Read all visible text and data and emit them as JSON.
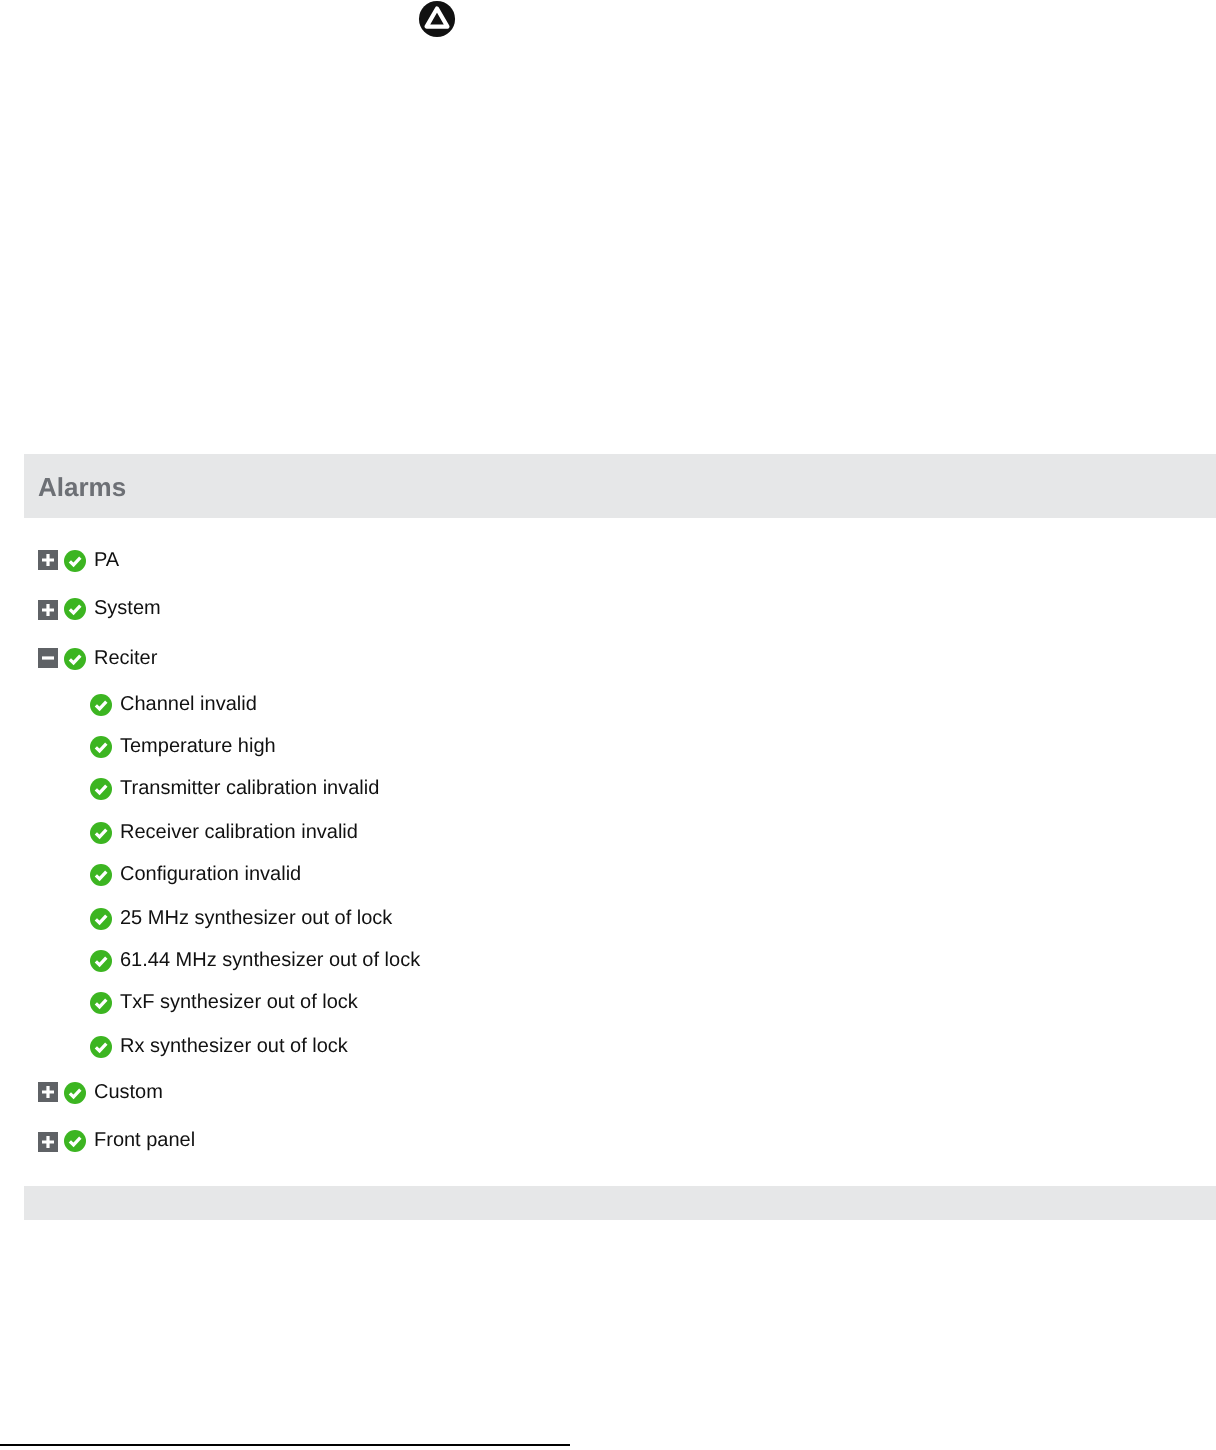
{
  "panel": {
    "title": "Alarms",
    "items": [
      {
        "label": "PA",
        "expanded": false
      },
      {
        "label": "System",
        "expanded": false
      },
      {
        "label": "Reciter",
        "expanded": true,
        "children": [
          {
            "label": "Channel invalid"
          },
          {
            "label": "Temperature high"
          },
          {
            "label": "Transmitter calibration invalid"
          },
          {
            "label": "Receiver calibration invalid"
          },
          {
            "label": "Configuration invalid"
          },
          {
            "label": "25 MHz synthesizer out of lock"
          },
          {
            "label": "61.44 MHz synthesizer out of lock"
          },
          {
            "label": "TxF synthesizer out of lock"
          },
          {
            "label": "Rx synthesizer out of lock"
          }
        ]
      },
      {
        "label": "Custom",
        "expanded": false
      },
      {
        "label": "Front panel",
        "expanded": false
      }
    ]
  }
}
